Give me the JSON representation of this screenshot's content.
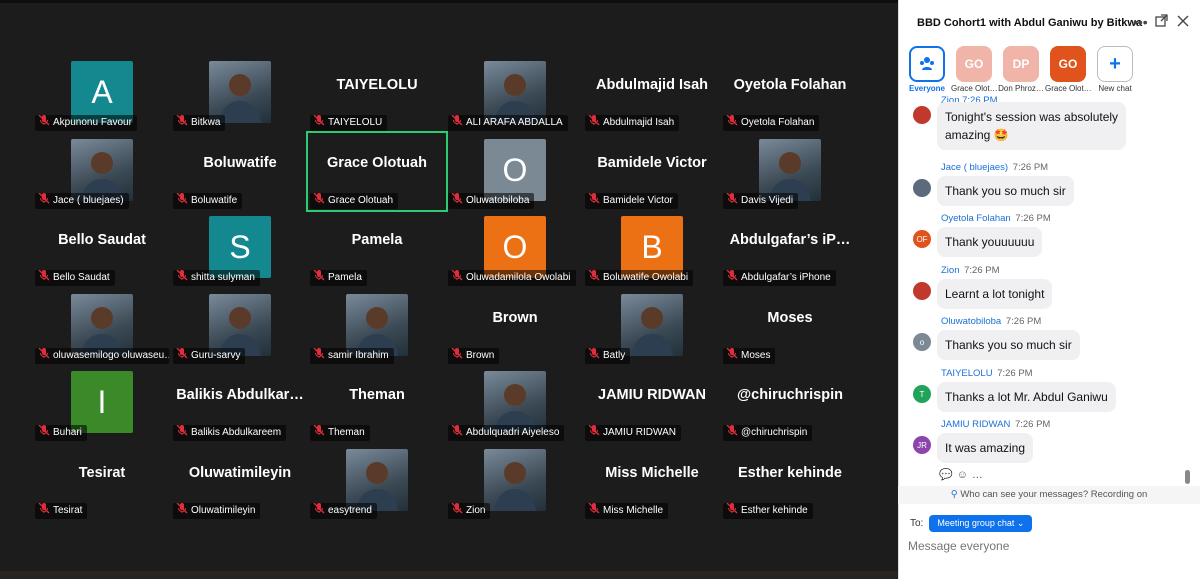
{
  "gallery": {
    "tiles": [
      {
        "name": "Akpunonu Favour",
        "avatar": "A",
        "color": "#13898f"
      },
      {
        "name": "Bitkwa",
        "photo": true
      },
      {
        "name": "TAIYELOLU",
        "bigname": "TAIYELOLU"
      },
      {
        "name": "ALI ARAFA ABDALLA",
        "photo": true
      },
      {
        "name": "Abdulmajid Isah",
        "bigname": "Abdulmajid Isah"
      },
      {
        "name": "Oyetola Folahan",
        "bigname": "Oyetola Folahan"
      },
      {
        "name": "Jace ( bluejaes)",
        "photo": true
      },
      {
        "name": "Boluwatife",
        "bigname": "Boluwatife"
      },
      {
        "name": "Grace Olotuah",
        "bigname": "Grace Olotuah",
        "active": true
      },
      {
        "name": "Oluwatobiloba",
        "avatar": "O",
        "color": "#7b8994"
      },
      {
        "name": "Bamidele Victor",
        "bigname": "Bamidele Victor"
      },
      {
        "name": "Davis Vijedi",
        "photo": true
      },
      {
        "name": "Bello Saudat",
        "bigname": "Bello Saudat"
      },
      {
        "name": "shitta sulyman",
        "avatar": "S",
        "color": "#13898f"
      },
      {
        "name": "Pamela",
        "bigname": "Pamela"
      },
      {
        "name": "Oluwadamilola Owolabi",
        "avatar": "O",
        "color": "#ec7014"
      },
      {
        "name": "Boluwatife Owolabi",
        "avatar": "B",
        "color": "#ec7014"
      },
      {
        "name": "Abdulgafar’s iPhone",
        "bigname": "Abdulgafar’s  iP…"
      },
      {
        "name": "oluwasemilogo oluwaseu…",
        "photo": true
      },
      {
        "name": "Guru-sarvy",
        "photo": true
      },
      {
        "name": "samir Ibrahim",
        "photo": true
      },
      {
        "name": "Brown",
        "bigname": "Brown"
      },
      {
        "name": "Batly",
        "photo": true
      },
      {
        "name": "Moses",
        "bigname": "Moses"
      },
      {
        "name": "Buhari",
        "avatar": "I",
        "color": "#3a8a2a"
      },
      {
        "name": "Balikis Abdulkareem",
        "bigname": "Balikis  Abdulkar…"
      },
      {
        "name": "Theman",
        "bigname": "Theman"
      },
      {
        "name": "Abdulquadri Aiyeleso",
        "photo": true
      },
      {
        "name": "JAMIU RIDWAN",
        "bigname": "JAMIU RIDWAN"
      },
      {
        "name": "@chiruchrispin",
        "bigname": "@chiruchrispin"
      },
      {
        "name": "Tesirat",
        "bigname": "Tesirat"
      },
      {
        "name": "Oluwatimileyin",
        "bigname": "Oluwatimileyin"
      },
      {
        "name": "easytrend",
        "photo": true
      },
      {
        "name": "Zion",
        "photo": true
      },
      {
        "name": "Miss Michelle",
        "bigname": "Miss Michelle"
      },
      {
        "name": "Esther kehinde",
        "bigname": "Esther kehinde"
      }
    ]
  },
  "chat": {
    "title": "BBD Cohort1 with Abdul Ganiwu by Bitkwa",
    "chips": [
      {
        "label": "Everyone",
        "text": "",
        "color": "#ffffff"
      },
      {
        "label": "Grace Olot…",
        "text": "GO",
        "color": "#f0b5a8"
      },
      {
        "label": "Don Phroz…",
        "text": "DP",
        "color": "#f0b5a8"
      },
      {
        "label": "Grace Olot…",
        "text": "GO",
        "color": "#e0531c"
      },
      {
        "label": "New chat",
        "text": "+",
        "color": "#ffffff"
      }
    ],
    "top_partial": "Zion 7:26 PM",
    "messages": [
      {
        "sender": "",
        "time": "",
        "text": "Tonight's session was absolutely",
        "text2": "amazing 🤩",
        "initials": "",
        "color": "#c0392b"
      },
      {
        "sender": "Jace ( bluejaes)",
        "time": "7:26 PM",
        "text": "Thank you so much sir",
        "initials": "",
        "color": "#5b6b7d"
      },
      {
        "sender": "Oyetola Folahan",
        "time": "7:26 PM",
        "text": "Thank youuuuuu",
        "initials": "OF",
        "color": "#e0531c"
      },
      {
        "sender": "Zion",
        "time": "7:26 PM",
        "text": "Learnt a lot tonight",
        "initials": "",
        "color": "#c0392b"
      },
      {
        "sender": "Oluwatobiloba",
        "time": "7:26 PM",
        "text": "Thanks you so much sir",
        "initials": "o",
        "color": "#7b8994"
      },
      {
        "sender": "TAIYELOLU",
        "time": "7:26 PM",
        "text": "Thanks a lot Mr. Abdul Ganiwu",
        "initials": "T",
        "color": "#21a35a"
      },
      {
        "sender": "JAMIU RIDWAN",
        "time": "7:26 PM",
        "text": "It was amazing",
        "initials": "JR",
        "color": "#8e44ad"
      }
    ],
    "privacy": "Who can see your messages? Recording on",
    "to_label": "To:",
    "to_value": "Meeting group chat",
    "compose_placeholder": "Message everyone"
  }
}
